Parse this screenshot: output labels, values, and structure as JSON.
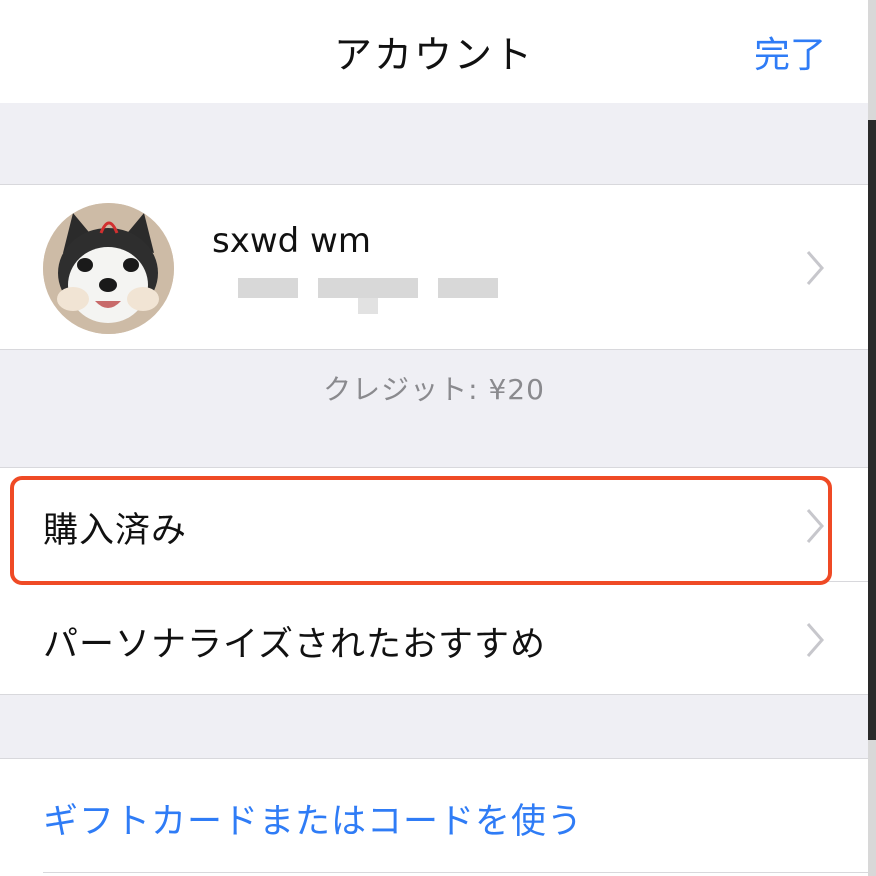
{
  "navbar": {
    "title": "アカウント",
    "done_label": "完了"
  },
  "account": {
    "name": "sxwd wm",
    "avatar_icon": "husky-dog-avatar-icon",
    "email_redacted": true
  },
  "credit": {
    "text": "クレジット: ¥20"
  },
  "rows": {
    "purchased": "購入済み",
    "personalized": "パーソナライズされたおすすめ",
    "redeem": "ギフトカードまたはコードを使う"
  },
  "colors": {
    "accent": "#2f7cf6",
    "highlight": "#ef4a25",
    "background": "#efeff4"
  },
  "icons": {
    "chevron": "chevron-right-icon"
  }
}
